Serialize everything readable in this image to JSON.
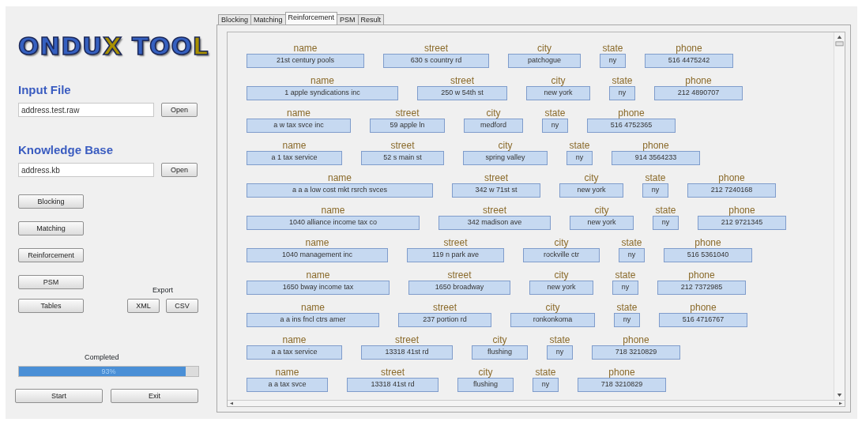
{
  "logo": {
    "parts": [
      {
        "text": "ONDU",
        "color": "#3560c0"
      },
      {
        "text": "X",
        "color": "#a89000"
      },
      {
        "text": " TOO",
        "color": "#3560c0"
      },
      {
        "text": "L",
        "color": "#a89000"
      }
    ]
  },
  "input_file": {
    "heading": "Input File",
    "value": "address.test.raw",
    "button": "Open"
  },
  "knowledge_base": {
    "heading": "Knowledge Base",
    "value": "address.kb",
    "button": "Open"
  },
  "steps": [
    "Blocking",
    "Matching",
    "Reinforcement",
    "PSM",
    "Tables"
  ],
  "export": {
    "label": "Export",
    "buttons": [
      "XML",
      "CSV"
    ]
  },
  "progress": {
    "label": "Completed",
    "level": 0.93,
    "reading": "93%"
  },
  "actions": [
    "Start",
    "Exit"
  ],
  "tabs": [
    {
      "label": "Blocking",
      "selected": false
    },
    {
      "label": "Matching",
      "selected": false
    },
    {
      "label": "Reinforcement",
      "selected": true
    },
    {
      "label": "PSM",
      "selected": false
    },
    {
      "label": "Result",
      "selected": false
    }
  ],
  "records": [
    [
      {
        "label": "name",
        "value": "21st century pools"
      },
      {
        "label": "street",
        "value": "630 s country rd"
      },
      {
        "label": "city",
        "value": "patchogue"
      },
      {
        "label": "state",
        "value": "ny"
      },
      {
        "label": "phone",
        "value": "516 4475242"
      }
    ],
    [
      {
        "label": "name",
        "value": "1 apple syndications inc"
      },
      {
        "label": "street",
        "value": "250 w 54th st"
      },
      {
        "label": "city",
        "value": "new york"
      },
      {
        "label": "state",
        "value": "ny"
      },
      {
        "label": "phone",
        "value": "212 4890707"
      }
    ],
    [
      {
        "label": "name",
        "value": "a w tax svce inc"
      },
      {
        "label": "street",
        "value": "59 apple ln"
      },
      {
        "label": "city",
        "value": "medford"
      },
      {
        "label": "state",
        "value": "ny"
      },
      {
        "label": "phone",
        "value": "516 4752365"
      }
    ],
    [
      {
        "label": "name",
        "value": "a 1 tax service"
      },
      {
        "label": "street",
        "value": "52 s main st"
      },
      {
        "label": "city",
        "value": "spring valley"
      },
      {
        "label": "state",
        "value": "ny"
      },
      {
        "label": "phone",
        "value": "914 3564233"
      }
    ],
    [
      {
        "label": "name",
        "value": "a a a low cost mkt rsrch svces"
      },
      {
        "label": "street",
        "value": "342 w 71st st"
      },
      {
        "label": "city",
        "value": "new york"
      },
      {
        "label": "state",
        "value": "ny"
      },
      {
        "label": "phone",
        "value": "212 7240168"
      }
    ],
    [
      {
        "label": "name",
        "value": "1040 alliance income tax co"
      },
      {
        "label": "street",
        "value": "342 madison ave"
      },
      {
        "label": "city",
        "value": "new york"
      },
      {
        "label": "state",
        "value": "ny"
      },
      {
        "label": "phone",
        "value": "212 9721345"
      }
    ],
    [
      {
        "label": "name",
        "value": "1040 management inc"
      },
      {
        "label": "street",
        "value": "119 n park ave"
      },
      {
        "label": "city",
        "value": "rockville ctr"
      },
      {
        "label": "state",
        "value": "ny"
      },
      {
        "label": "phone",
        "value": "516 5361040"
      }
    ],
    [
      {
        "label": "name",
        "value": "1650 bway income tax"
      },
      {
        "label": "street",
        "value": "1650 broadway"
      },
      {
        "label": "city",
        "value": "new york"
      },
      {
        "label": "state",
        "value": "ny"
      },
      {
        "label": "phone",
        "value": "212 7372985"
      }
    ],
    [
      {
        "label": "name",
        "value": "a a ins fncl ctrs amer"
      },
      {
        "label": "street",
        "value": "237 portion rd"
      },
      {
        "label": "city",
        "value": "ronkonkoma"
      },
      {
        "label": "state",
        "value": "ny"
      },
      {
        "label": "phone",
        "value": "516 4716767"
      }
    ],
    [
      {
        "label": "name",
        "value": "a a tax service"
      },
      {
        "label": "street",
        "value": "13318 41st rd"
      },
      {
        "label": "city",
        "value": "flushing"
      },
      {
        "label": "state",
        "value": "ny"
      },
      {
        "label": "phone",
        "value": "718 3210829"
      }
    ],
    [
      {
        "label": "name",
        "value": "a a tax svce"
      },
      {
        "label": "street",
        "value": "13318 41st rd"
      },
      {
        "label": "city",
        "value": "flushing"
      },
      {
        "label": "state",
        "value": "ny"
      },
      {
        "label": "phone",
        "value": "718 3210829"
      }
    ]
  ]
}
